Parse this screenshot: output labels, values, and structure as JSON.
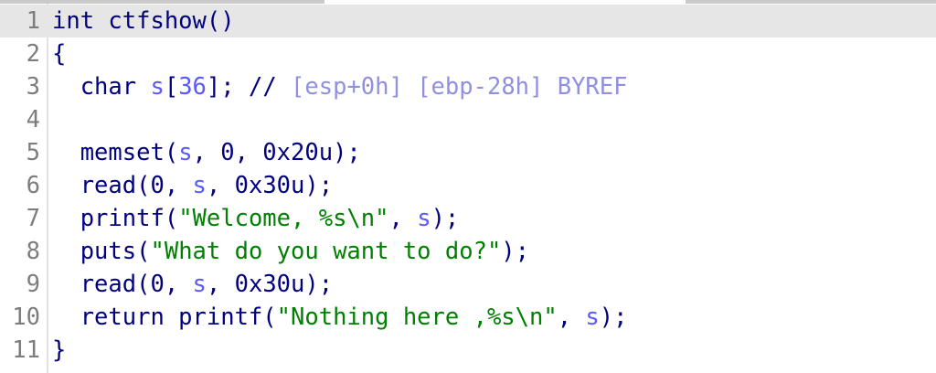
{
  "editor": {
    "lines": [
      {
        "num": "1",
        "parts": [
          {
            "t": "int",
            "c": "kw"
          },
          {
            "t": " ctfshow",
            "c": "fn"
          },
          {
            "t": "()",
            "c": "pun"
          }
        ]
      },
      {
        "num": "2",
        "parts": [
          {
            "t": "{",
            "c": "pun"
          }
        ]
      },
      {
        "num": "3",
        "parts": [
          {
            "t": "  char ",
            "c": "kw"
          },
          {
            "t": "s",
            "c": "var"
          },
          {
            "t": "[",
            "c": "pun"
          },
          {
            "t": "36",
            "c": "var"
          },
          {
            "t": "]; ",
            "c": "pun"
          },
          {
            "t": "// ",
            "c": "pun"
          },
          {
            "t": "[esp+0h] [ebp-28h] BYREF",
            "c": "cmt"
          }
        ]
      },
      {
        "num": "4",
        "parts": []
      },
      {
        "num": "5",
        "parts": [
          {
            "t": "  memset",
            "c": "fn"
          },
          {
            "t": "(",
            "c": "pun"
          },
          {
            "t": "s",
            "c": "var"
          },
          {
            "t": ", 0, 0x20u);",
            "c": "num"
          }
        ]
      },
      {
        "num": "6",
        "parts": [
          {
            "t": "  read",
            "c": "fn"
          },
          {
            "t": "(0, ",
            "c": "num"
          },
          {
            "t": "s",
            "c": "var"
          },
          {
            "t": ", 0x30u);",
            "c": "num"
          }
        ]
      },
      {
        "num": "7",
        "parts": [
          {
            "t": "  printf",
            "c": "fn"
          },
          {
            "t": "(",
            "c": "pun"
          },
          {
            "t": "\"Welcome, %s\\n\"",
            "c": "str"
          },
          {
            "t": ", ",
            "c": "pun"
          },
          {
            "t": "s",
            "c": "var"
          },
          {
            "t": ");",
            "c": "pun"
          }
        ]
      },
      {
        "num": "8",
        "parts": [
          {
            "t": "  puts",
            "c": "fn"
          },
          {
            "t": "(",
            "c": "pun"
          },
          {
            "t": "\"What do you want to do?\"",
            "c": "str"
          },
          {
            "t": ");",
            "c": "pun"
          }
        ]
      },
      {
        "num": "9",
        "parts": [
          {
            "t": "  read",
            "c": "fn"
          },
          {
            "t": "(0, ",
            "c": "num"
          },
          {
            "t": "s",
            "c": "var"
          },
          {
            "t": ", 0x30u);",
            "c": "num"
          }
        ]
      },
      {
        "num": "10",
        "parts": [
          {
            "t": "  return ",
            "c": "kw"
          },
          {
            "t": "printf",
            "c": "fn"
          },
          {
            "t": "(",
            "c": "pun"
          },
          {
            "t": "\"Nothing here ,%s\\n\"",
            "c": "str"
          },
          {
            "t": ", ",
            "c": "pun"
          },
          {
            "t": "s",
            "c": "var"
          },
          {
            "t": ");",
            "c": "pun"
          }
        ]
      },
      {
        "num": "11",
        "parts": [
          {
            "t": "}",
            "c": "pun"
          }
        ]
      }
    ],
    "current_line": 0,
    "colors": {
      "keyword": "#000080",
      "variable": "#5a5aff",
      "string": "#008000",
      "comment": "#9090e0",
      "line_number": "#7d7d7d",
      "current_line_bg": "#e6e6e6"
    }
  }
}
